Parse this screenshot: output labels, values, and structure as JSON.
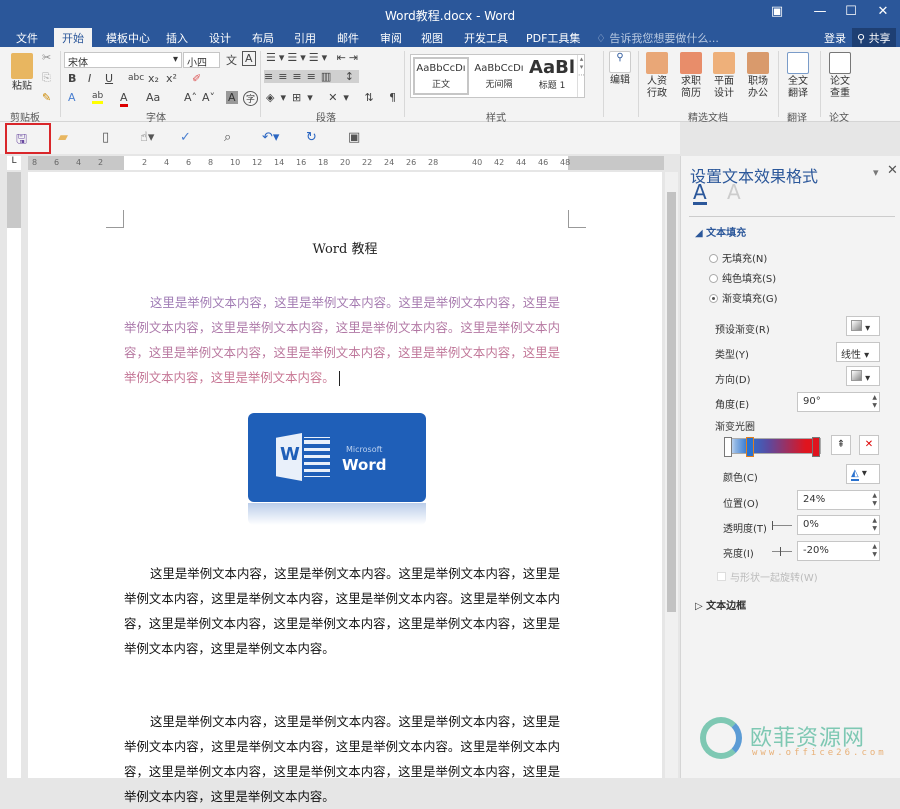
{
  "window": {
    "title": "Word教程.docx - Word",
    "controls": [
      "▣",
      "—",
      "☐",
      "✕"
    ]
  },
  "tabs": [
    "文件",
    "开始",
    "模板中心",
    "插入",
    "设计",
    "布局",
    "引用",
    "邮件",
    "审阅",
    "视图",
    "开发工具",
    "PDF工具集"
  ],
  "active_tab": "开始",
  "tell_me": "告诉我您想要做什么...",
  "login": "登录",
  "share": "共享",
  "ribbon": {
    "clipboard": {
      "paste": "粘贴",
      "label": "剪贴板"
    },
    "font": {
      "name": "宋体",
      "size": "小四",
      "label": "字体",
      "buttons": [
        "B",
        "I",
        "U",
        "abc",
        "x₂",
        "x²"
      ],
      "row3": [
        "A",
        "ab",
        "A",
        "Aa",
        "A˄",
        "A˅",
        "A",
        "字"
      ]
    },
    "paragraph": {
      "label": "段落"
    },
    "styles": {
      "items": [
        {
          "preview": "AaBbCcDı",
          "name": "正文"
        },
        {
          "preview": "AaBbCcDı",
          "name": "无间隔"
        },
        {
          "preview": "AaBl",
          "name": "标题 1"
        }
      ],
      "label": "样式"
    },
    "edit": {
      "label": "编辑"
    },
    "docs": {
      "items": [
        "人资\n行政",
        "求职\n简历",
        "平面\n设计",
        "职场\n办公"
      ],
      "label": "精选文档"
    },
    "translate": {
      "button": "全文\n翻译",
      "label": "翻译"
    },
    "paper": {
      "button": "论文\n查重",
      "label": "论文"
    }
  },
  "ruler": {
    "ticks": [
      "8",
      "6",
      "4",
      "2",
      "",
      "2",
      "4",
      "6",
      "8",
      "10",
      "12",
      "14",
      "16",
      "18",
      "20",
      "22",
      "24",
      "26",
      "28",
      "",
      "40",
      "42",
      "44",
      "46",
      "48"
    ]
  },
  "document": {
    "title": "Word 教程",
    "para1": "这里是举例文本内容，这里是举例文本内容。这里是举例文本内容，这里是举例文本内容，这里是举例文本内容，这里是举例文本内容。这里是举例文本内容，这里是举例文本内容，这里是举例文本内容，这里是举例文本内容，这里是举例文本内容，这里是举例文本内容。",
    "logo": {
      "small": "Microsoft",
      "big": "Word",
      "letter": "W"
    },
    "para2": "这里是举例文本内容，这里是举例文本内容。这里是举例文本内容，这里是举例文本内容，这里是举例文本内容，这里是举例文本内容。这里是举例文本内容，这里是举例文本内容，这里是举例文本内容，这里是举例文本内容，这里是举例文本内容，这里是举例文本内容。",
    "para3": "这里是举例文本内容，这里是举例文本内容。这里是举例文本内容，这里是举例文本内容，这里是举例文本内容，这里是举例文本内容。这里是举例文本内容，这里是举例文本内容，这里是举例文本内容，这里是举例文本内容，这里是举例文本内容，这里是举例文本内容。"
  },
  "pane": {
    "title": "设置文本效果格式",
    "section_fill": "文本填充",
    "fill_options": [
      "无填充(N)",
      "纯色填充(S)",
      "渐变填充(G)"
    ],
    "selected_fill": "渐变填充(G)",
    "preset_label": "预设渐变(R)",
    "type_label": "类型(Y)",
    "type_value": "线性",
    "direction_label": "方向(D)",
    "angle_label": "角度(E)",
    "angle_value": "90°",
    "stops_label": "渐变光圈",
    "color_label": "颜色(C)",
    "position_label": "位置(O)",
    "position_value": "24%",
    "transparency_label": "透明度(T)",
    "transparency_value": "0%",
    "brightness_label": "亮度(I)",
    "brightness_value": "-20%",
    "rotate_label": "与形状一起旋转(W)",
    "section_outline": "文本边框"
  },
  "watermark": {
    "name": "欧菲资源网",
    "url": "www.office26.com"
  },
  "colors": {
    "brand": "#2b579a",
    "highlight": "#d9262a"
  }
}
